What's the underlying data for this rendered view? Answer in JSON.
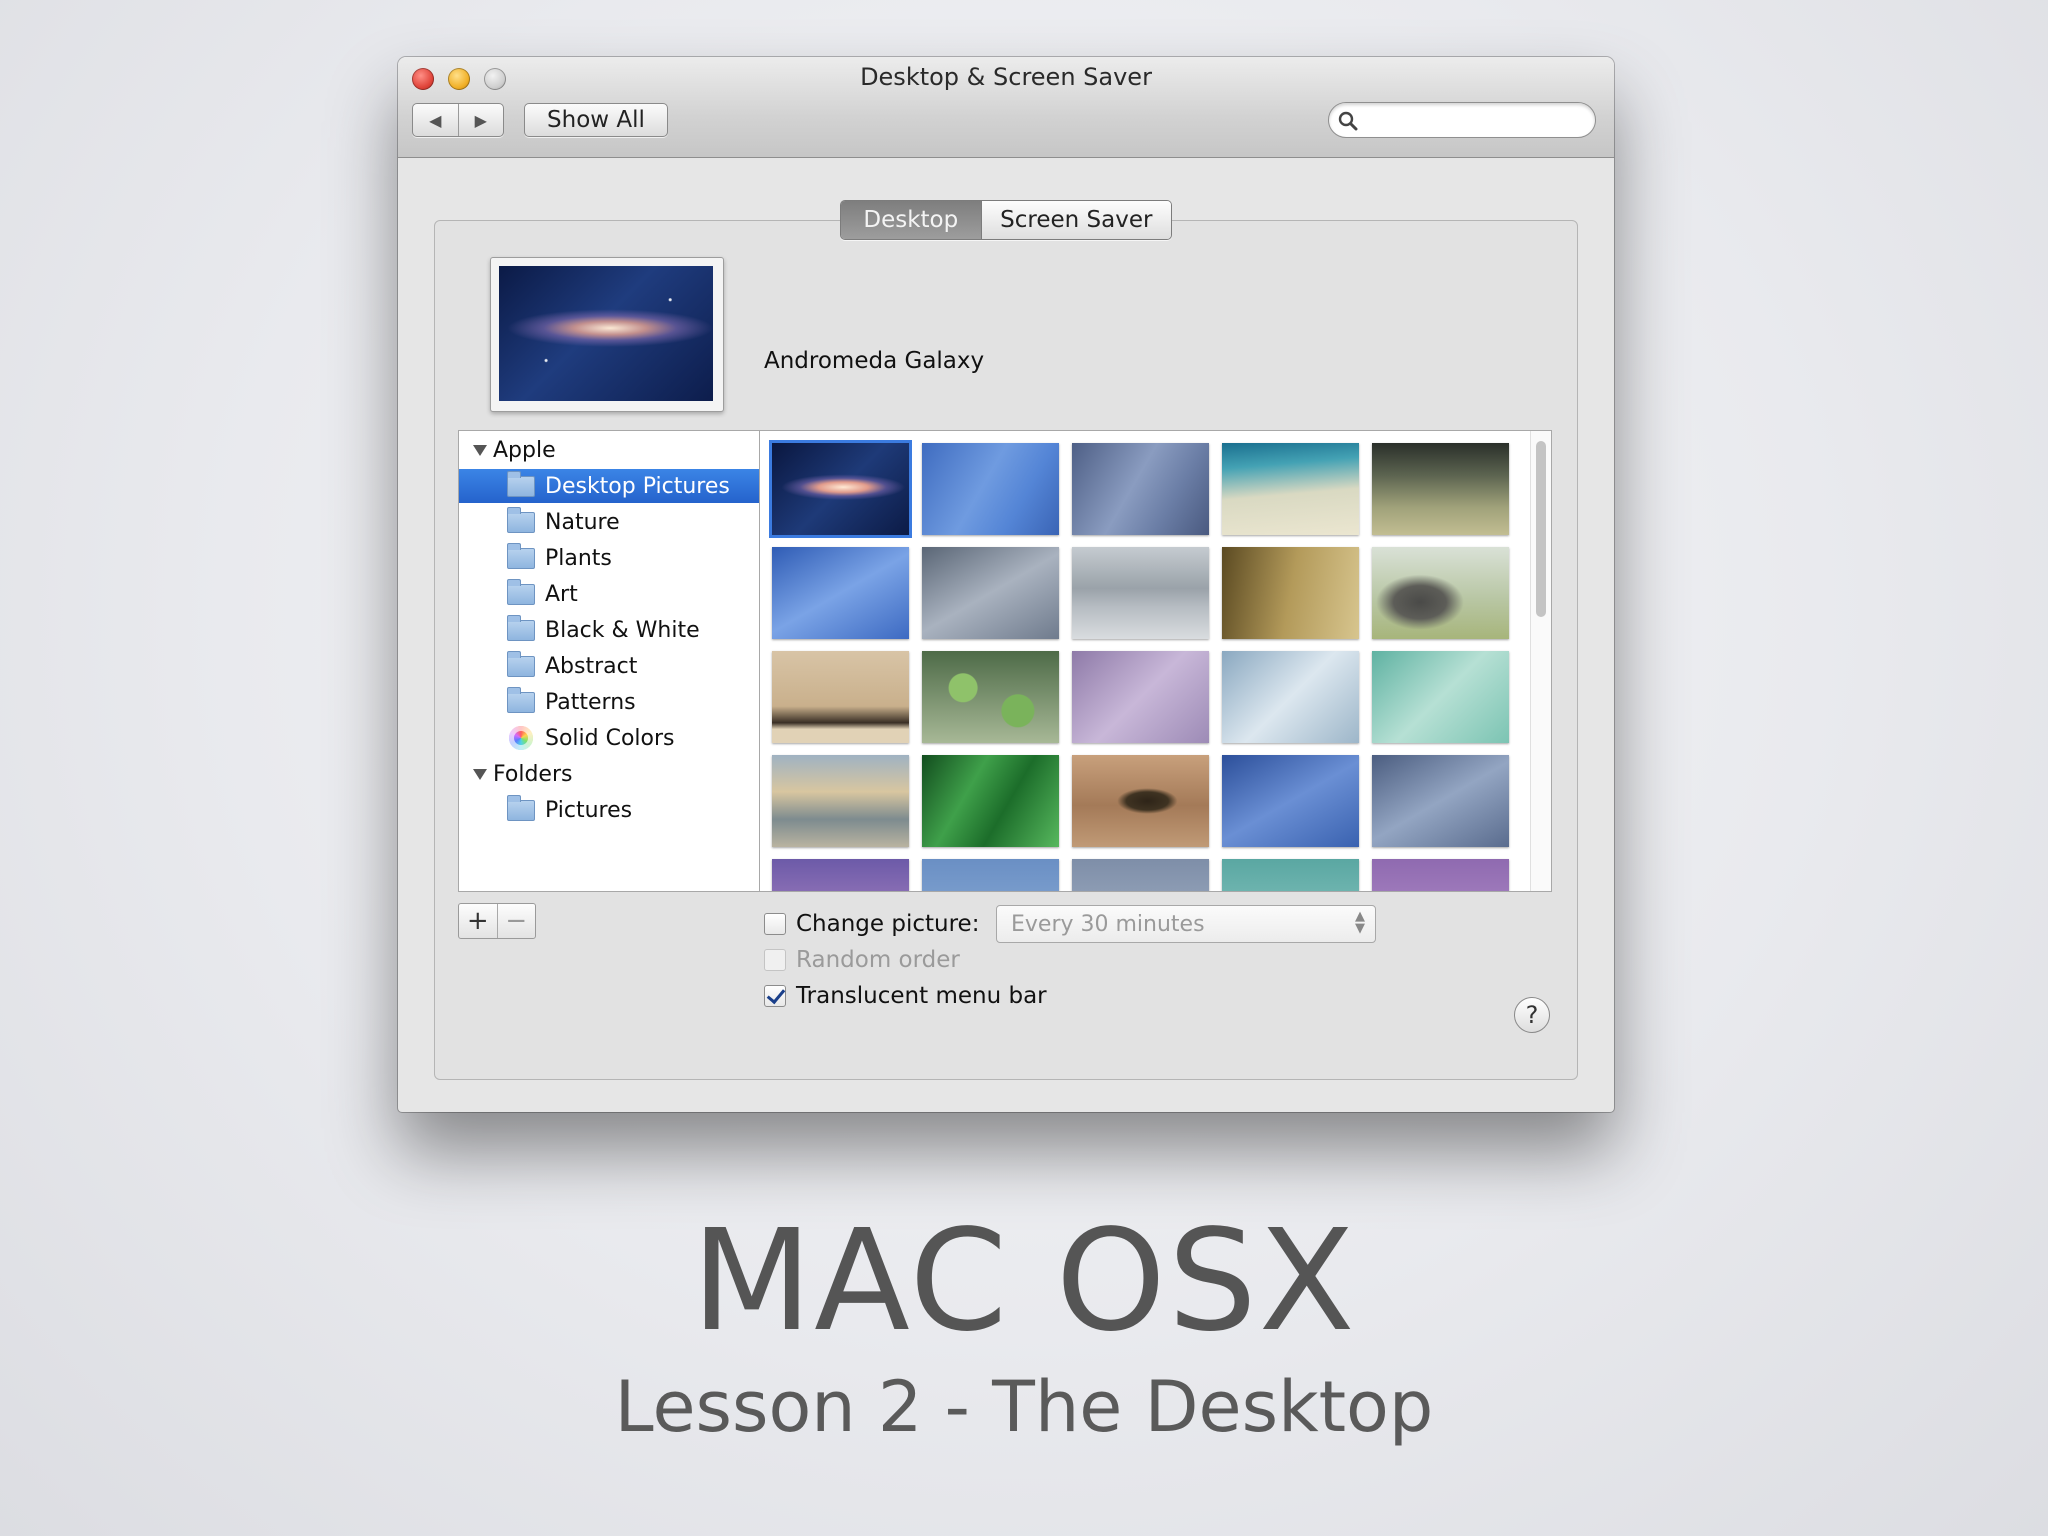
{
  "window": {
    "title": "Desktop & Screen Saver",
    "nav_back_icon": "triangle-left",
    "nav_forward_icon": "triangle-right",
    "show_all_label": "Show All",
    "search_placeholder": ""
  },
  "tabs": [
    {
      "label": "Desktop",
      "selected": true
    },
    {
      "label": "Screen Saver",
      "selected": false
    }
  ],
  "preview": {
    "name": "Andromeda Galaxy"
  },
  "sources": [
    {
      "label": "Apple",
      "type": "group"
    },
    {
      "label": "Desktop Pictures",
      "type": "folder",
      "selected": true
    },
    {
      "label": "Nature",
      "type": "folder"
    },
    {
      "label": "Plants",
      "type": "folder"
    },
    {
      "label": "Art",
      "type": "folder"
    },
    {
      "label": "Black & White",
      "type": "folder"
    },
    {
      "label": "Abstract",
      "type": "folder"
    },
    {
      "label": "Patterns",
      "type": "folder"
    },
    {
      "label": "Solid Colors",
      "type": "colors"
    },
    {
      "label": "Folders",
      "type": "group"
    },
    {
      "label": "Pictures",
      "type": "folder"
    }
  ],
  "controls": {
    "add_label": "+",
    "remove_label": "−",
    "change_picture_label": "Change picture:",
    "change_picture_checked": false,
    "interval_value": "Every 30 minutes",
    "random_order_label": "Random order",
    "random_order_checked": false,
    "translucent_label": "Translucent menu bar",
    "translucent_checked": true,
    "help_label": "?"
  },
  "colors": {
    "selection_blue": "#2f74d9",
    "slide_text": "#555555"
  },
  "slide": {
    "title": "MAC OSX",
    "subtitle": "Lesson 2 - The Desktop"
  }
}
